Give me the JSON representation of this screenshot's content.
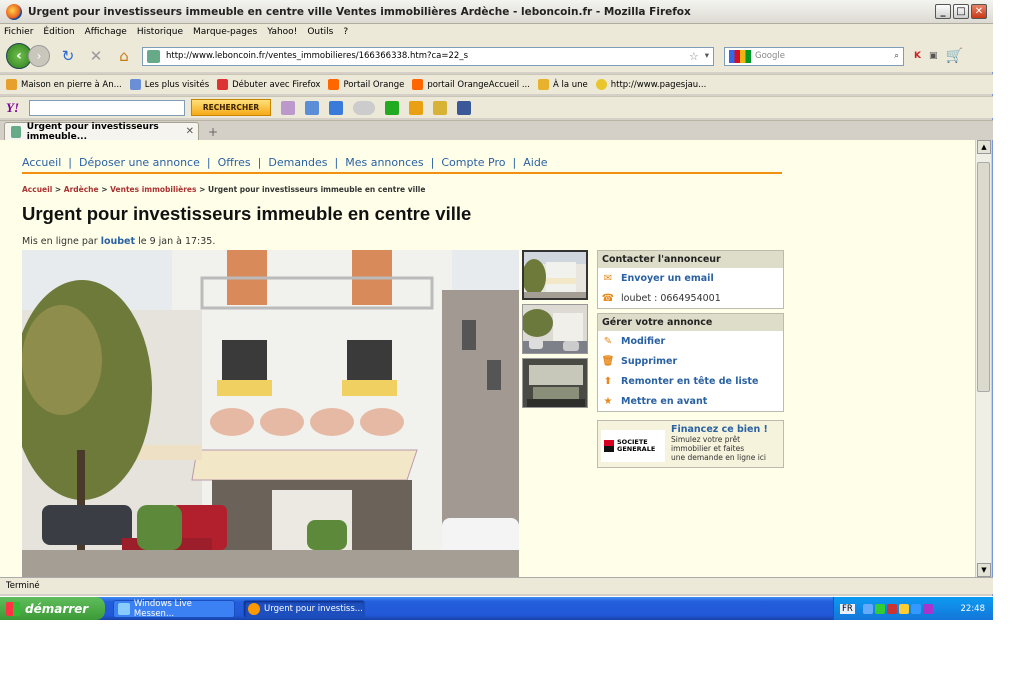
{
  "window": {
    "title": "Urgent pour investisseurs immeuble en centre ville Ventes immobilières Ardèche - leboncoin.fr - Mozilla Firefox"
  },
  "menu": [
    "Fichier",
    "Édition",
    "Affichage",
    "Historique",
    "Marque-pages",
    "Yahoo!",
    "Outils",
    "?"
  ],
  "nav": {
    "url": "http://www.leboncoin.fr/ventes_immobilieres/166366338.htm?ca=22_s",
    "search_placeholder": "Google"
  },
  "bookmarks": [
    "Maison en pierre à An...",
    "Les plus visités",
    "Débuter avec Firefox",
    "Portail Orange",
    "portail OrangeAccueil ...",
    "À la une",
    "http://www.pagesjau..."
  ],
  "yahoo": {
    "logo": "Y!",
    "search_button": "RECHERCHER"
  },
  "tab": {
    "label": "Urgent pour investisseurs immeuble..."
  },
  "site": {
    "topnav": [
      "Accueil",
      "Déposer une annonce",
      "Offres",
      "Demandes",
      "Mes annonces",
      "Compte Pro",
      "Aide"
    ],
    "breadcrumb": {
      "home": "Accueil",
      "region": "Ardèche",
      "category": "Ventes immobilières",
      "current": "Urgent pour investisseurs immeuble en centre ville"
    },
    "title": "Urgent pour investisseurs immeuble en centre ville",
    "posted_prefix": "Mis en ligne par",
    "posted_user": "loubet",
    "posted_suffix": "le 9 jan à 17:35.",
    "contact": {
      "header": "Contacter l'annonceur",
      "email": "Envoyer un email",
      "phone_label": "loubet :",
      "phone": "0664954001"
    },
    "manage": {
      "header": "Gérer votre annonce",
      "items": [
        "Modifier",
        "Supprimer",
        "Remonter en tête de liste",
        "Mettre en avant"
      ]
    },
    "finance": {
      "logo_line1": "SOCIETE",
      "logo_line2": "GENERALE",
      "title": "Financez ce bien !",
      "desc1": "Simulez votre prêt",
      "desc2": "immobilier et faites",
      "desc3": "une demande en ligne ici"
    }
  },
  "status": "Terminé",
  "taskbar": {
    "start": "démarrer",
    "tasks": [
      "Windows Live Messen...",
      "Urgent pour investiss..."
    ],
    "lang": "FR",
    "time": "22:48"
  }
}
